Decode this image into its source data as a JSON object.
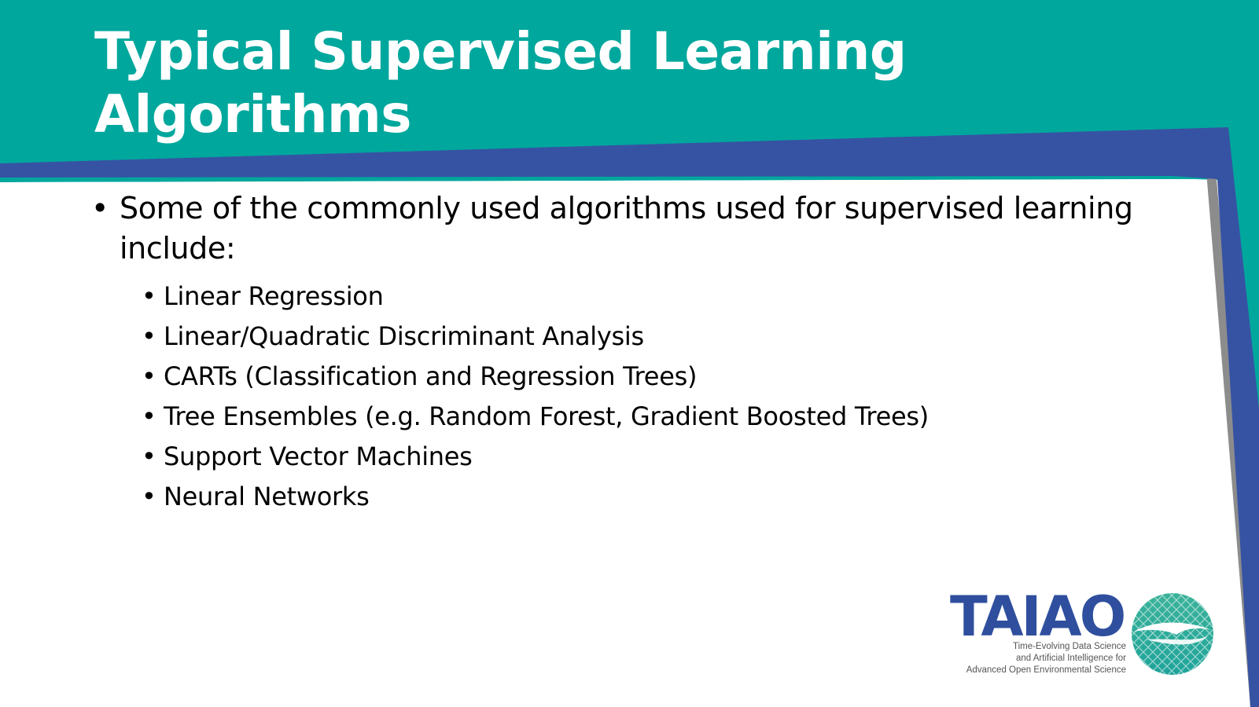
{
  "slide": {
    "title": "Typical Supervised Learning Algorithms",
    "main_bullet": "Some of the commonly used algorithms used for supervised learning include:",
    "sub_bullets": [
      "Linear Regression",
      "Linear/Quadratic Discriminant Analysis",
      "CARTs (Classification and Regression Trees)",
      "Tree Ensembles (e.g. Random Forest, Gradient Boosted Trees)",
      "Support Vector Machines",
      "Neural Networks"
    ],
    "bullet_glyph": "•"
  },
  "logo": {
    "wordmark": "TAIAO",
    "tagline_line1": "Time-Evolving Data Science",
    "tagline_line2": "and Artificial Intelligence for",
    "tagline_line3": "Advanced Open Environmental Science"
  },
  "colors": {
    "teal": "#00a79d",
    "blue": "#3653a3",
    "gray": "#8c8c8c",
    "logo_blue": "#2f4f9e"
  }
}
